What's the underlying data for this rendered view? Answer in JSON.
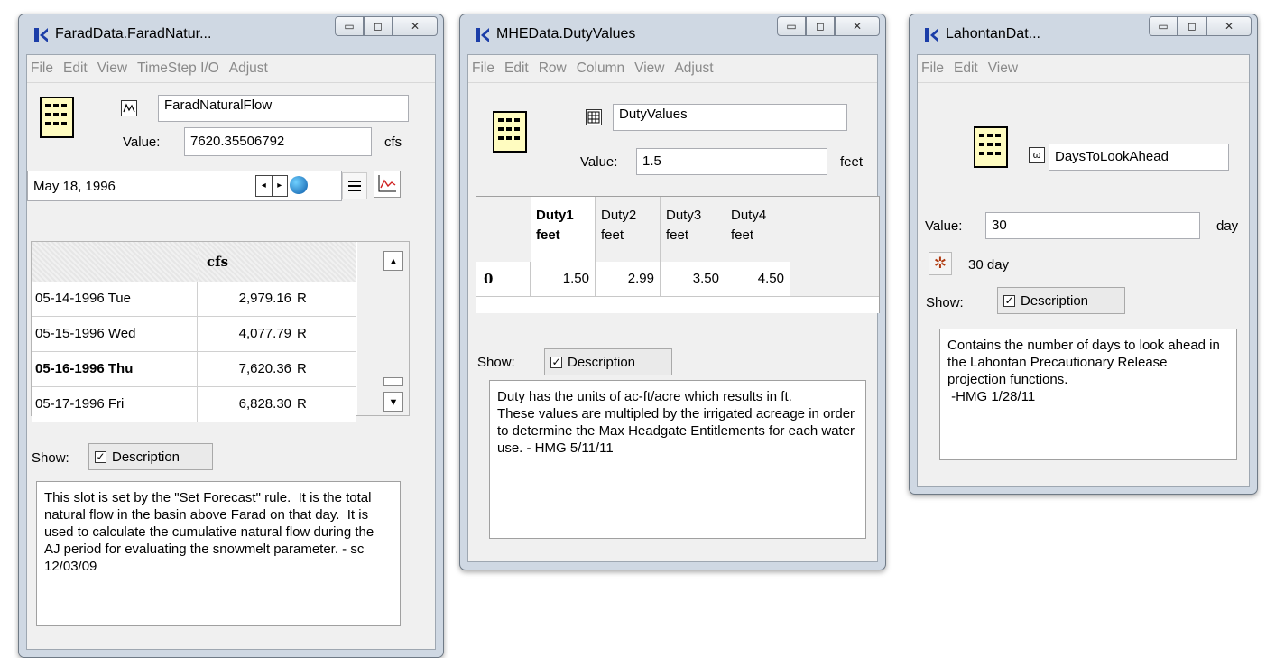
{
  "colors": {
    "window_frame": "#cfd8e3",
    "client_bg": "#f0f0f0",
    "grid_icon_fill": "#fffcc0",
    "app_icon_blue": "#1c3ea8"
  },
  "window1": {
    "title": "FaradData.FaradNatur...",
    "menu": [
      "File",
      "Edit",
      "View",
      "TimeStep I/O",
      "Adjust"
    ],
    "slot_type_icon": "series-slot-icon",
    "slot_name": "FaradNaturalFlow",
    "value_label": "Value:",
    "value": "7620.35506792",
    "unit": "cfs",
    "date": "May 18, 1996",
    "table": {
      "column_header": "cfs",
      "rows": [
        {
          "date": "05-14-1996 Tue",
          "value": "2,979.16",
          "flag": "R",
          "bold": false
        },
        {
          "date": "05-15-1996 Wed",
          "value": "4,077.79",
          "flag": "R",
          "bold": false
        },
        {
          "date": "05-16-1996 Thu",
          "value": "7,620.36",
          "flag": "R",
          "bold": true
        },
        {
          "date": "05-17-1996 Fri",
          "value": "6,828.30",
          "flag": "R",
          "bold": false
        }
      ]
    },
    "show_label": "Show:",
    "description_toggle": "Description",
    "description": "This slot is set by the \"Set Forecast\" rule.  It is the total natural flow in the basin above Farad on that day.  It is used to calculate the cumulative natural flow during the AJ period for evaluating the snowmelt parameter. - sc 12/03/09"
  },
  "window2": {
    "title": "MHEData.DutyValues",
    "menu": [
      "File",
      "Edit",
      "Row",
      "Column",
      "View",
      "Adjust"
    ],
    "slot_type_icon": "table-slot-icon",
    "slot_name": "DutyValues",
    "value_label": "Value:",
    "value": "1.5",
    "unit": "feet",
    "columns": [
      {
        "name": "Duty1",
        "unit": "feet"
      },
      {
        "name": "Duty2",
        "unit": "feet"
      },
      {
        "name": "Duty3",
        "unit": "feet"
      },
      {
        "name": "Duty4",
        "unit": "feet"
      }
    ],
    "row_label": "0",
    "row_values": [
      "1.50",
      "2.99",
      "3.50",
      "4.50"
    ],
    "show_label": "Show:",
    "description_toggle": "Description",
    "description": "Duty has the units of ac-ft/acre which results in ft.\nThese values are multipled by the irrigated acreage in order to determine the Max Headgate Entitlements for each water use. - HMG 5/11/11"
  },
  "window3": {
    "title": "LahontanDat...",
    "menu": [
      "File",
      "Edit",
      "View"
    ],
    "slot_type_icon": "scalar-slot-icon",
    "slot_name": "DaysToLookAhead",
    "value_label": "Value:",
    "value": "30",
    "unit": "day",
    "converted": "30 day",
    "show_label": "Show:",
    "description_toggle": "Description",
    "description": "Contains the number of days to look ahead in the Lahontan Precautionary Release projection functions.\n -HMG 1/28/11"
  }
}
